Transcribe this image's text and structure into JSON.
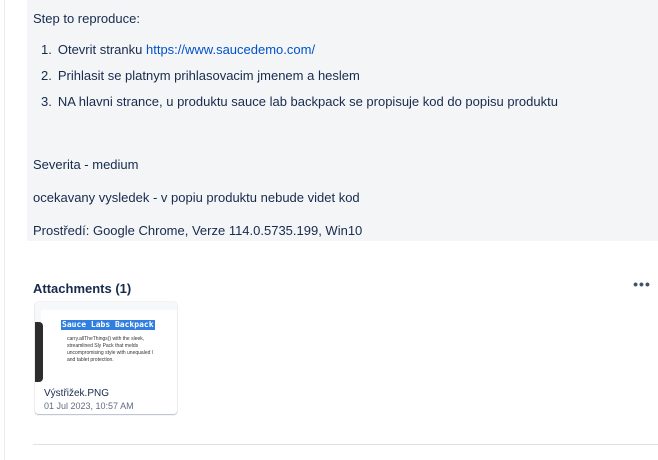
{
  "description": {
    "steps_heading": "Step to reproduce:",
    "steps": [
      {
        "num": "1.",
        "text": "Otevrit stranku ",
        "link": "https://www.saucedemo.com/"
      },
      {
        "num": "2.",
        "text": "Prihlasit se platnym prihlasovacim jmenem a heslem"
      },
      {
        "num": "3.",
        "text": "NA hlavni strance, u produktu sauce lab backpack se propisuje kod do popisu produktu"
      }
    ],
    "severity": "Severita - medium",
    "expected": "ocekavany vysledek - v popiu produktu nebude videt kod",
    "environment": "Prostředí: Google Chrome, Verze 114.0.5735.199, Win10"
  },
  "attachments": {
    "title": "Attachments (1)",
    "more_icon": "more-horizontal-icon",
    "items": [
      {
        "file_name": "Výstřižek.PNG",
        "date": "01 Jul 2023, 10:57 AM",
        "thumbnail": {
          "heading": "Sauce Labs Backpack",
          "lines": [
            "carry.allTheThings() with the sleek,",
            "streamlined Sly Pack that melds",
            "uncompromising style with unequaled l",
            "and tablet protection."
          ]
        }
      }
    ]
  },
  "colors": {
    "link": "#0052cc",
    "panel_bg": "#f4f5f7",
    "highlight": "#2f7ee0"
  }
}
